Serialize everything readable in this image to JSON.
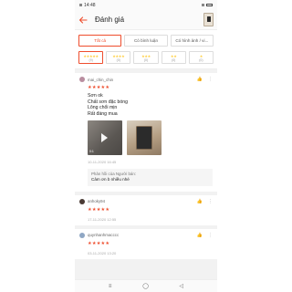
{
  "status": {
    "time": "14:48"
  },
  "header": {
    "title": "Đánh giá"
  },
  "tabs": [
    {
      "label": "Tất cả",
      "active": true
    },
    {
      "label": "Có bình luận",
      "count": ""
    },
    {
      "label": "Có hình ảnh / vi..."
    }
  ],
  "star_filters": [
    {
      "stars": "★★★★★",
      "count": "(9)"
    },
    {
      "stars": "★★★★",
      "count": "(0)"
    },
    {
      "stars": "★★★",
      "count": "(0)"
    },
    {
      "stars": "★★",
      "count": "(0)"
    },
    {
      "stars": "★",
      "count": "(0)"
    }
  ],
  "reviews": [
    {
      "username": "mai_chin_chin",
      "rating": 5,
      "rating_text": "★★★★★",
      "lines": [
        "Sơn ok",
        "Chất sơn đặc bóng",
        "Lông chổi mịn",
        "Rất đáng mua"
      ],
      "video_duration": "0:1",
      "date": "10-11-2020 16:45",
      "reply_label": "Phản hồi của Người bán:",
      "reply_text": "Cảm ơn b nhiều nhé"
    },
    {
      "username": "anhoky94",
      "rating": 5,
      "rating_text": "★★★★★",
      "date": "17-11-2020 12:55"
    },
    {
      "username": "quynhanhmacccc",
      "rating": 5,
      "rating_text": "★★★★★",
      "date": "03-11-2020 13:20"
    }
  ],
  "icons": {
    "back": "arrow-left-icon",
    "like": "thumbs-up-icon",
    "more": "more-vertical-icon"
  },
  "colors": {
    "accent": "#ee4d2d",
    "star": "#ffce3d"
  }
}
